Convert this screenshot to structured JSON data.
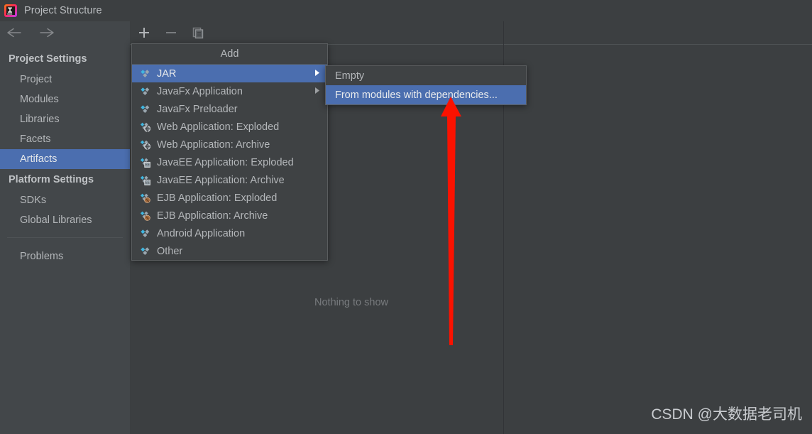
{
  "window": {
    "title": "Project Structure",
    "app_icon": "intellij-idea-logo"
  },
  "navigation": {
    "back_icon": "arrow-left-icon",
    "forward_icon": "arrow-right-icon"
  },
  "sidebar": {
    "groups": [
      {
        "heading": "Project Settings",
        "items": [
          {
            "label": "Project",
            "selected": false
          },
          {
            "label": "Modules",
            "selected": false
          },
          {
            "label": "Libraries",
            "selected": false
          },
          {
            "label": "Facets",
            "selected": false
          },
          {
            "label": "Artifacts",
            "selected": true
          }
        ]
      },
      {
        "heading": "Platform Settings",
        "items": [
          {
            "label": "SDKs",
            "selected": false
          },
          {
            "label": "Global Libraries",
            "selected": false
          }
        ]
      }
    ],
    "problems_label": "Problems"
  },
  "toolbar": {
    "add_icon": "plus-icon",
    "remove_icon": "minus-icon",
    "copy_icon": "copy-icon"
  },
  "content": {
    "empty_message": "Nothing to show"
  },
  "add_menu": {
    "title": "Add",
    "items": [
      {
        "label": "JAR",
        "icon": "jar-icon",
        "submenu": true,
        "highlight": true
      },
      {
        "label": "JavaFx Application",
        "icon": "javafx-icon",
        "submenu": true,
        "highlight": false
      },
      {
        "label": "JavaFx Preloader",
        "icon": "javafx-icon",
        "submenu": false,
        "highlight": false
      },
      {
        "label": "Web Application: Exploded",
        "icon": "web-icon",
        "submenu": false,
        "highlight": false
      },
      {
        "label": "Web Application: Archive",
        "icon": "web-icon",
        "submenu": false,
        "highlight": false
      },
      {
        "label": "JavaEE Application: Exploded",
        "icon": "javaee-icon",
        "submenu": false,
        "highlight": false
      },
      {
        "label": "JavaEE Application: Archive",
        "icon": "javaee-icon",
        "submenu": false,
        "highlight": false
      },
      {
        "label": "EJB Application: Exploded",
        "icon": "ejb-icon",
        "submenu": false,
        "highlight": false
      },
      {
        "label": "EJB Application: Archive",
        "icon": "ejb-icon",
        "submenu": false,
        "highlight": false
      },
      {
        "label": "Android Application",
        "icon": "android-icon",
        "submenu": false,
        "highlight": false
      },
      {
        "label": "Other",
        "icon": "other-icon",
        "submenu": false,
        "highlight": false
      }
    ]
  },
  "jar_submenu": {
    "items": [
      {
        "label": "Empty",
        "highlight": false
      },
      {
        "label": "From modules with dependencies...",
        "highlight": true
      }
    ]
  },
  "annotation": {
    "arrow_color": "#fb1200",
    "arrow_icon": "red-up-arrow"
  },
  "watermark": {
    "text": "CSDN @大数据老司机"
  },
  "colors": {
    "selection_blue": "#4b6eaf",
    "panel_bg": "#3c3f41",
    "sidebar_bg": "#43474a",
    "menu_bg": "#3f4244",
    "text": "#b4b7ba"
  }
}
